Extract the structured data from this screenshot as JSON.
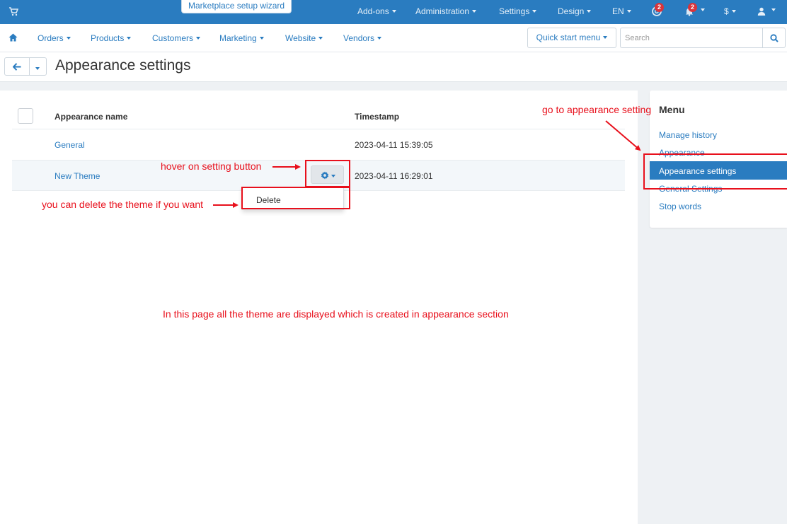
{
  "topbar": {
    "wizard_label": "Marketplace setup wizard",
    "menus": [
      "Add-ons",
      "Administration",
      "Settings",
      "Design",
      "EN",
      "$"
    ],
    "help_badge": "2",
    "notifications_badge": "2",
    "colors": {
      "bar": "#2a7cc0",
      "badge": "#d9343b"
    }
  },
  "nav": {
    "items": [
      "Orders",
      "Products",
      "Customers",
      "Marketing",
      "Website",
      "Vendors"
    ],
    "quick_start": "Quick start menu",
    "search_placeholder": "Search"
  },
  "page": {
    "title": "Appearance settings"
  },
  "table": {
    "headers": {
      "name": "Appearance name",
      "timestamp": "Timestamp"
    },
    "rows": [
      {
        "name": "General",
        "timestamp": "2023-04-11 15:39:05"
      },
      {
        "name": "New Theme",
        "timestamp": "2023-04-11 16:29:01"
      }
    ],
    "dropdown_delete": "Delete"
  },
  "sidebar": {
    "title": "Menu",
    "items": [
      "Manage history",
      "Appearance",
      "Appearance settings",
      "General Settings",
      "Stop words"
    ],
    "active_index": 2
  },
  "annotations": {
    "go_to": "go to appearance setting",
    "hover": "hover on setting button",
    "delete_hint": "you can delete the theme if you want",
    "page_info": "In this page all the theme are displayed which is created in appearance section",
    "color": "#e8101c"
  }
}
